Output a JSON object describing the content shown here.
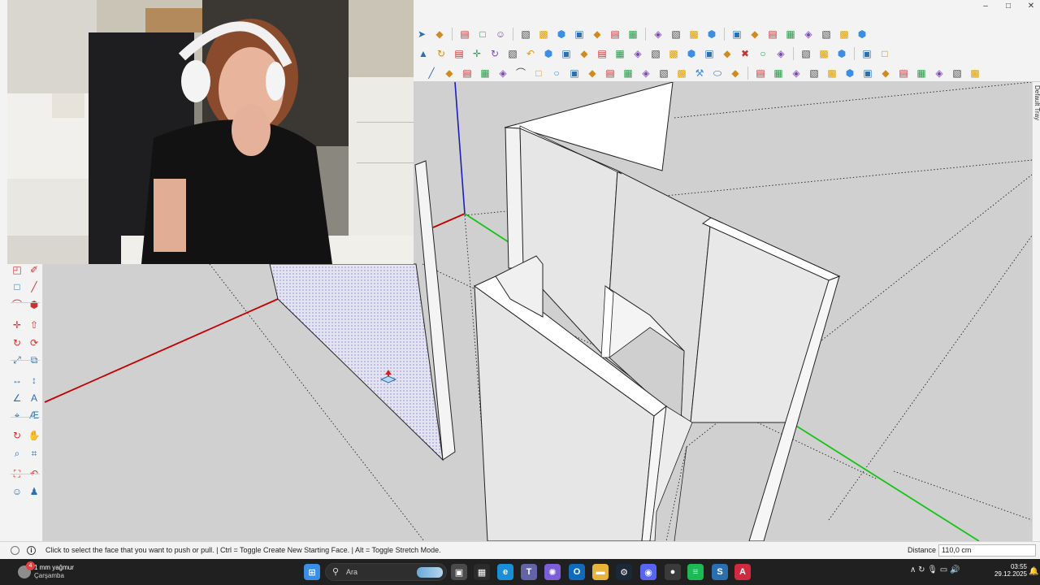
{
  "window": {
    "minimize_label": "–",
    "maximize_label": "□",
    "close_label": "✕"
  },
  "toolbars": {
    "row1": [
      "select-arrow-icon",
      "layers-icon",
      "warehouse-icon",
      "new-file-icon",
      "person-icon",
      "styles-icon",
      "materials-icon",
      "push-pull-icon",
      "follow-me-icon",
      "offset-icon",
      "protractor-icon",
      "section-icon",
      "copy-icon",
      "paste-icon",
      "group-icon",
      "component-icon",
      "outliner-icon",
      "iso-view-icon",
      "top-view-icon",
      "front-view-icon",
      "right-view-icon",
      "back-view-icon",
      "left-view-icon",
      "bottom-view-icon"
    ],
    "row2": [
      "warning-icon",
      "rotate-icon",
      "paint-icon",
      "move-icon",
      "orbit-icon",
      "bucket-icon",
      "undo-arc-icon",
      "extension-icon",
      "plugin-icon",
      "eraser-icon",
      "gears-icon",
      "solid-icon",
      "layout-icon",
      "grid-icon",
      "texture-icon",
      "orange-grid-icon",
      "yellow-grid-icon",
      "solid-tools-icon",
      "cross-icon",
      "circle-icon",
      "dimension-icon",
      "cut-icon",
      "select-x-icon",
      "draw-line-icon",
      "bezier-icon",
      "rectangle-icon"
    ],
    "row3": [
      "line-tool-icon",
      "freehand-icon",
      "paint-brush-icon",
      "polyline-icon",
      "curve-icon",
      "arc-icon",
      "square-icon",
      "circle-tool-icon",
      "arc-2pt-icon",
      "arc-3pt-icon",
      "pie-icon",
      "arc-tan-icon",
      "arc-open-icon",
      "zigzag-icon",
      "circle-outline-icon",
      "wrench-icon",
      "ellipse-icon",
      "tag-icon",
      "move-sel-icon",
      "scale-sel-icon",
      "rotate-sel-icon",
      "extrude-icon",
      "box-1-icon",
      "box-2-icon",
      "box-3-icon",
      "box-4-icon",
      "box-5-icon",
      "box-6-icon",
      "box-7-icon",
      "box-8-icon",
      "box-9-icon"
    ]
  },
  "left_palette": [
    "select-tool-icon",
    "eraser-tool-icon",
    "rectangle-tool-icon",
    "line-tool-icon",
    "arc-tool-icon",
    "polygon-tool-icon",
    "move-tool-icon",
    "push-pull-tool-icon",
    "rotate-tool-icon",
    "follow-me-tool-icon",
    "scale-tool-icon",
    "offset-tool-icon",
    "tape-measure-icon",
    "dimension-tool-icon",
    "protractor-icon",
    "text-tool-icon",
    "axes-tool-icon",
    "3d-text-icon",
    "orbit-tool-icon",
    "pan-tool-icon",
    "zoom-tool-icon",
    "zoom-window-icon",
    "zoom-extents-icon",
    "previous-view-icon",
    "position-camera-icon",
    "walk-tool-icon",
    "look-around-icon",
    "section-plane-icon",
    "sandbox-icon",
    "stamp-icon",
    "drape-icon",
    "add-detail-icon"
  ],
  "right_tray": {
    "label": "Default Tray"
  },
  "status": {
    "hint": "Click to select the face that you want to push or pull. | Ctrl = Toggle Create New Starting Face. | Alt = Toggle Stretch Mode.",
    "vcb_label": "Distance",
    "vcb_value": "110,0 cm"
  },
  "taskbar": {
    "weather_badge": "4",
    "weather_temp": "1 mm yağmur",
    "weather_day": "Çarşamba",
    "search_placeholder": "Ara",
    "clock_time": "03:55",
    "clock_date": "29.12.2025",
    "apps": [
      {
        "name": "windows-start-icon",
        "color": "#3a8ee6",
        "glyph": "⊞"
      },
      {
        "name": "task-view-icon",
        "color": "#4a4a4a",
        "glyph": "▣"
      },
      {
        "name": "store-icon",
        "color": "#2b2b2b",
        "glyph": "▦"
      },
      {
        "name": "edge-icon",
        "color": "#1a8ed6",
        "glyph": "e"
      },
      {
        "name": "teams-icon",
        "color": "#6264a7",
        "glyph": "T"
      },
      {
        "name": "copilot-icon",
        "color": "#7b5fd6",
        "glyph": "✺"
      },
      {
        "name": "outlook-icon",
        "color": "#0f6cbd",
        "glyph": "O"
      },
      {
        "name": "explorer-icon",
        "color": "#e7b33c",
        "glyph": "▬"
      },
      {
        "name": "steam-icon",
        "color": "#1b2838",
        "glyph": "⚙"
      },
      {
        "name": "discord-icon",
        "color": "#5865f2",
        "glyph": "◉"
      },
      {
        "name": "obs-icon",
        "color": "#3a3a3a",
        "glyph": "●"
      },
      {
        "name": "spotify-icon",
        "color": "#1db954",
        "glyph": "≡"
      },
      {
        "name": "sketchup-taskbar-icon",
        "color": "#2a6fb0",
        "glyph": "S"
      },
      {
        "name": "app-red-icon",
        "color": "#d02a3f",
        "glyph": "A"
      }
    ],
    "tray": "∧  ↻  🎙  ▭  🔊"
  }
}
